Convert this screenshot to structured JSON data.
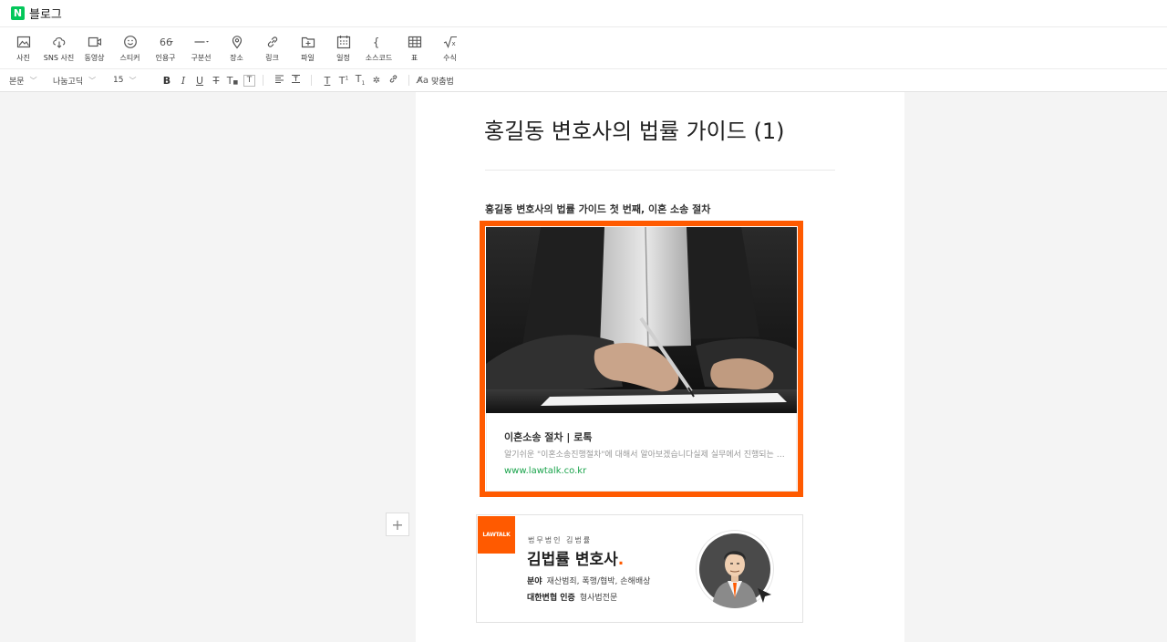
{
  "app": {
    "logo_letter": "N",
    "title": "블로그"
  },
  "toolbar": {
    "items": [
      {
        "icon": "image-icon",
        "label": "사진"
      },
      {
        "icon": "cloud-download-icon",
        "label": "SNS 사진"
      },
      {
        "icon": "video-icon",
        "label": "동영상"
      },
      {
        "icon": "smiley-icon",
        "label": "스티커"
      },
      {
        "icon": "quote-icon",
        "label": "인용구"
      },
      {
        "icon": "divider-icon",
        "label": "구분선"
      },
      {
        "icon": "map-pin-icon",
        "label": "장소"
      },
      {
        "icon": "link-icon",
        "label": "링크"
      },
      {
        "icon": "file-icon",
        "label": "파일"
      },
      {
        "icon": "calendar-icon",
        "label": "일정"
      },
      {
        "icon": "code-icon",
        "label": "소스코드"
      },
      {
        "icon": "table-icon",
        "label": "표"
      },
      {
        "icon": "formula-icon",
        "label": "수식"
      }
    ]
  },
  "format_bar": {
    "paragraph_style": "본문",
    "font": "나눔고딕",
    "font_size": "15",
    "spellcheck_label": "맞춤법"
  },
  "post": {
    "title": "홍길동 변호사의 법률 가이드 (1)",
    "subtitle": "홍길동 변호사의 법률 가이드 첫 번째, 이혼 소송 절차",
    "link_card": {
      "title": "이혼소송 절차 | 로톡",
      "description": "알기쉬운 \"이혼소송진행절차\"에 대해서 알아보겠습니다실제 실무에서 진행되는 이혼소송 절차",
      "url": "www.lawtalk.co.kr"
    },
    "profile": {
      "logo_text": "LAWTALK",
      "firm": "법무법인 김법률",
      "name": "김법률 변호사",
      "name_dot": ".",
      "field_label": "분야",
      "field_value": "재산범죄, 폭행/협박, 손해배상",
      "cert_label": "대한변협 인증",
      "cert_value": "형사법전문"
    }
  },
  "colors": {
    "accent": "#ff5a00",
    "naver_green": "#03c75a",
    "link_green": "#19a34b"
  }
}
